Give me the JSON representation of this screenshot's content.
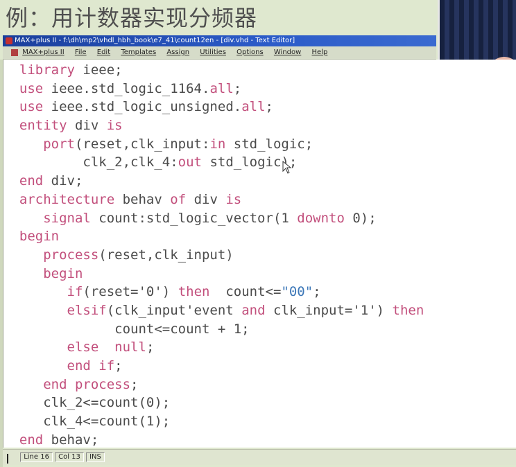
{
  "slide": {
    "heading": "例：用计数器实现分频器"
  },
  "window": {
    "title": "MAX+plus II - f:\\dh\\mp2\\vhdl_hbh_book\\e7_41\\count12en - [div.vhd - Text Editor]"
  },
  "menu": {
    "items": [
      "MAX+plus II",
      "File",
      "Edit",
      "Templates",
      "Assign",
      "Utilities",
      "Options",
      "Window",
      "Help"
    ]
  },
  "code": {
    "lines": [
      [
        {
          "t": "  "
        },
        {
          "t": "library",
          "k": 1
        },
        {
          "t": " ieee;"
        }
      ],
      [
        {
          "t": "  "
        },
        {
          "t": "use",
          "k": 1
        },
        {
          "t": " ieee.std_logic_1164."
        },
        {
          "t": "all",
          "k": 1
        },
        {
          "t": ";"
        }
      ],
      [
        {
          "t": "  "
        },
        {
          "t": "use",
          "k": 1
        },
        {
          "t": " ieee.std_logic_unsigned."
        },
        {
          "t": "all",
          "k": 1
        },
        {
          "t": ";"
        }
      ],
      [
        {
          "t": "  "
        },
        {
          "t": "entity",
          "k": 1
        },
        {
          "t": " div "
        },
        {
          "t": "is",
          "k": 1
        }
      ],
      [
        {
          "t": "     "
        },
        {
          "t": "port",
          "k": 1
        },
        {
          "t": "(reset,clk_input:"
        },
        {
          "t": "in",
          "k": 1
        },
        {
          "t": " std_logic;"
        }
      ],
      [
        {
          "t": "          clk_2,clk_4:"
        },
        {
          "t": "out",
          "k": 1
        },
        {
          "t": " std_logic);"
        }
      ],
      [
        {
          "t": "  "
        },
        {
          "t": "end",
          "k": 1
        },
        {
          "t": " div;"
        }
      ],
      [
        {
          "t": "  "
        },
        {
          "t": "architecture",
          "k": 1
        },
        {
          "t": " behav "
        },
        {
          "t": "of",
          "k": 1
        },
        {
          "t": " div "
        },
        {
          "t": "is",
          "k": 1
        }
      ],
      [
        {
          "t": "     "
        },
        {
          "t": "signal",
          "k": 1
        },
        {
          "t": " count:std_logic_vector(1 "
        },
        {
          "t": "downto",
          "k": 1
        },
        {
          "t": " 0);"
        }
      ],
      [
        {
          "t": "  "
        },
        {
          "t": "begin",
          "k": 1
        }
      ],
      [
        {
          "t": "     "
        },
        {
          "t": "process",
          "k": 1
        },
        {
          "t": "(reset,clk_input)"
        }
      ],
      [
        {
          "t": "     "
        },
        {
          "t": "begin",
          "k": 1
        }
      ],
      [
        {
          "t": "        "
        },
        {
          "t": "if",
          "k": 1
        },
        {
          "t": "(reset='0') "
        },
        {
          "t": "then",
          "k": 1
        },
        {
          "t": "  count<="
        },
        {
          "t": "\"00\"",
          "s": 1
        },
        {
          "t": ";"
        }
      ],
      [
        {
          "t": "        "
        },
        {
          "t": "elsif",
          "k": 1
        },
        {
          "t": "(clk_input'event "
        },
        {
          "t": "and",
          "k": 1
        },
        {
          "t": " clk_input='1') "
        },
        {
          "t": "then",
          "k": 1
        }
      ],
      [
        {
          "t": "              count<=count + 1;"
        }
      ],
      [
        {
          "t": "        "
        },
        {
          "t": "else",
          "k": 1
        },
        {
          "t": "  "
        },
        {
          "t": "null",
          "k": 1
        },
        {
          "t": ";"
        }
      ],
      [
        {
          "t": "        "
        },
        {
          "t": "end if",
          "k": 1
        },
        {
          "t": ";"
        }
      ],
      [
        {
          "t": "     "
        },
        {
          "t": "end process",
          "k": 1
        },
        {
          "t": ";"
        }
      ],
      [
        {
          "t": "     clk_2<=count(0);"
        }
      ],
      [
        {
          "t": "     clk_4<=count(1);"
        }
      ],
      [
        {
          "t": "  "
        },
        {
          "t": "end",
          "k": 1
        },
        {
          "t": " behav;"
        }
      ]
    ]
  },
  "status": {
    "line": "Line   16",
    "col": "Col   13",
    "mode": "INS"
  },
  "colors": {
    "keyword": "#c24f7c",
    "string": "#3d78b8",
    "text": "#4b4b4b",
    "titlebar": "#1a3f9c"
  }
}
